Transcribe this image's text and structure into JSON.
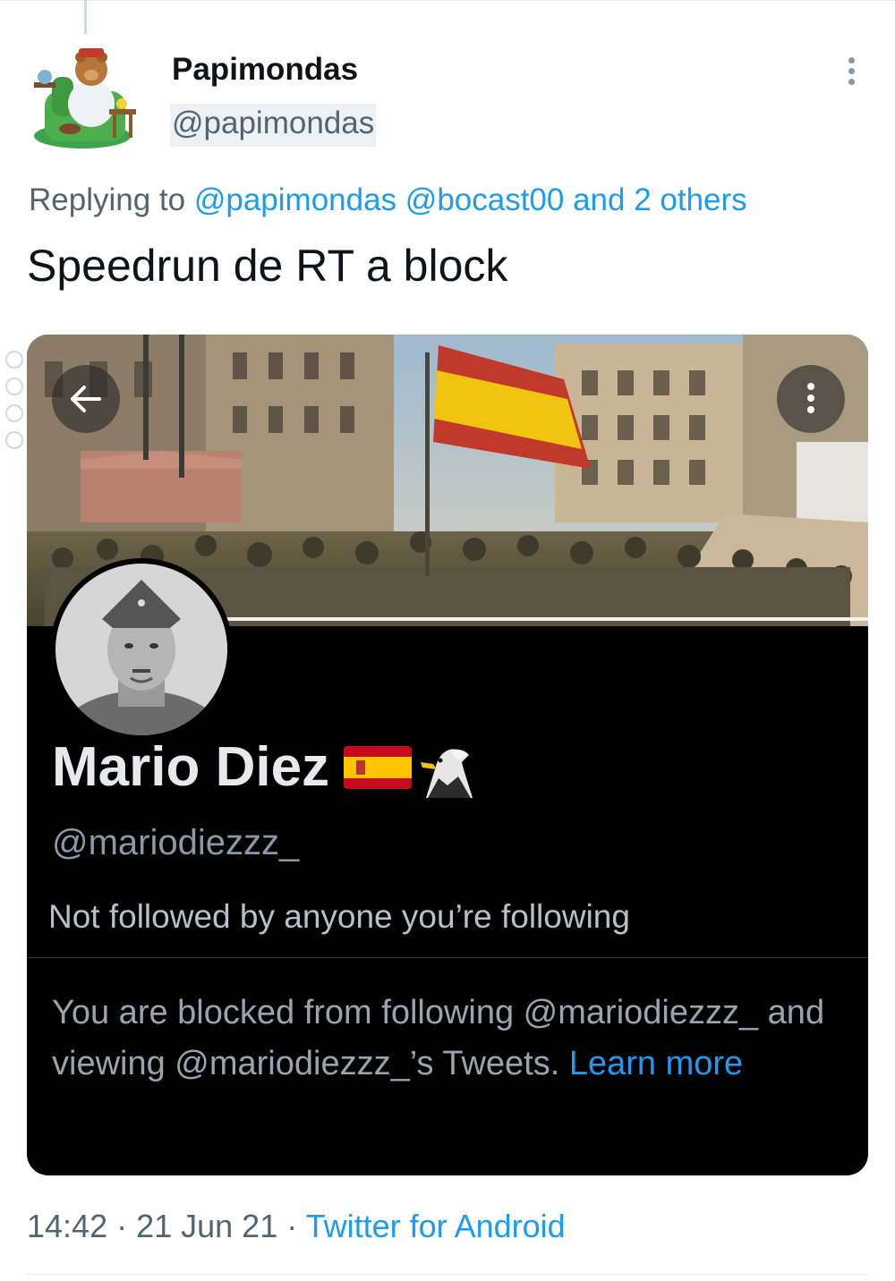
{
  "tweet": {
    "author_name": "Papimondas",
    "author_handle": "@papimondas",
    "replying_prefix": "Replying to",
    "replying_mentions": "@papimondas @bocast00 and 2 others",
    "text": "Speedrun de RT a block",
    "time": "14:42",
    "separator": " · ",
    "date": "21 Jun 21",
    "source": "Twitter for Android",
    "avatar_icon": "bear-in-armchair-avatar",
    "more_icon": "more-vertical-icon"
  },
  "embedded_profile": {
    "name": "Mario Diez",
    "name_emojis": [
      "flag-spain-icon",
      "eagle-icon"
    ],
    "handle": "@mariodiezzz_",
    "follow_context": "Not followed by anyone you’re following",
    "blocked_message": "You are blocked from following @mariodiezzz_ and viewing @mariodiezzz_’s Tweets.",
    "learn_more": "Learn more",
    "back_icon": "arrow-left-icon",
    "menu_icon": "more-vertical-icon"
  },
  "colors": {
    "accent": "#1d9bf0",
    "text_primary": "#0f1419",
    "text_secondary": "#536471",
    "card_background": "#000000"
  }
}
